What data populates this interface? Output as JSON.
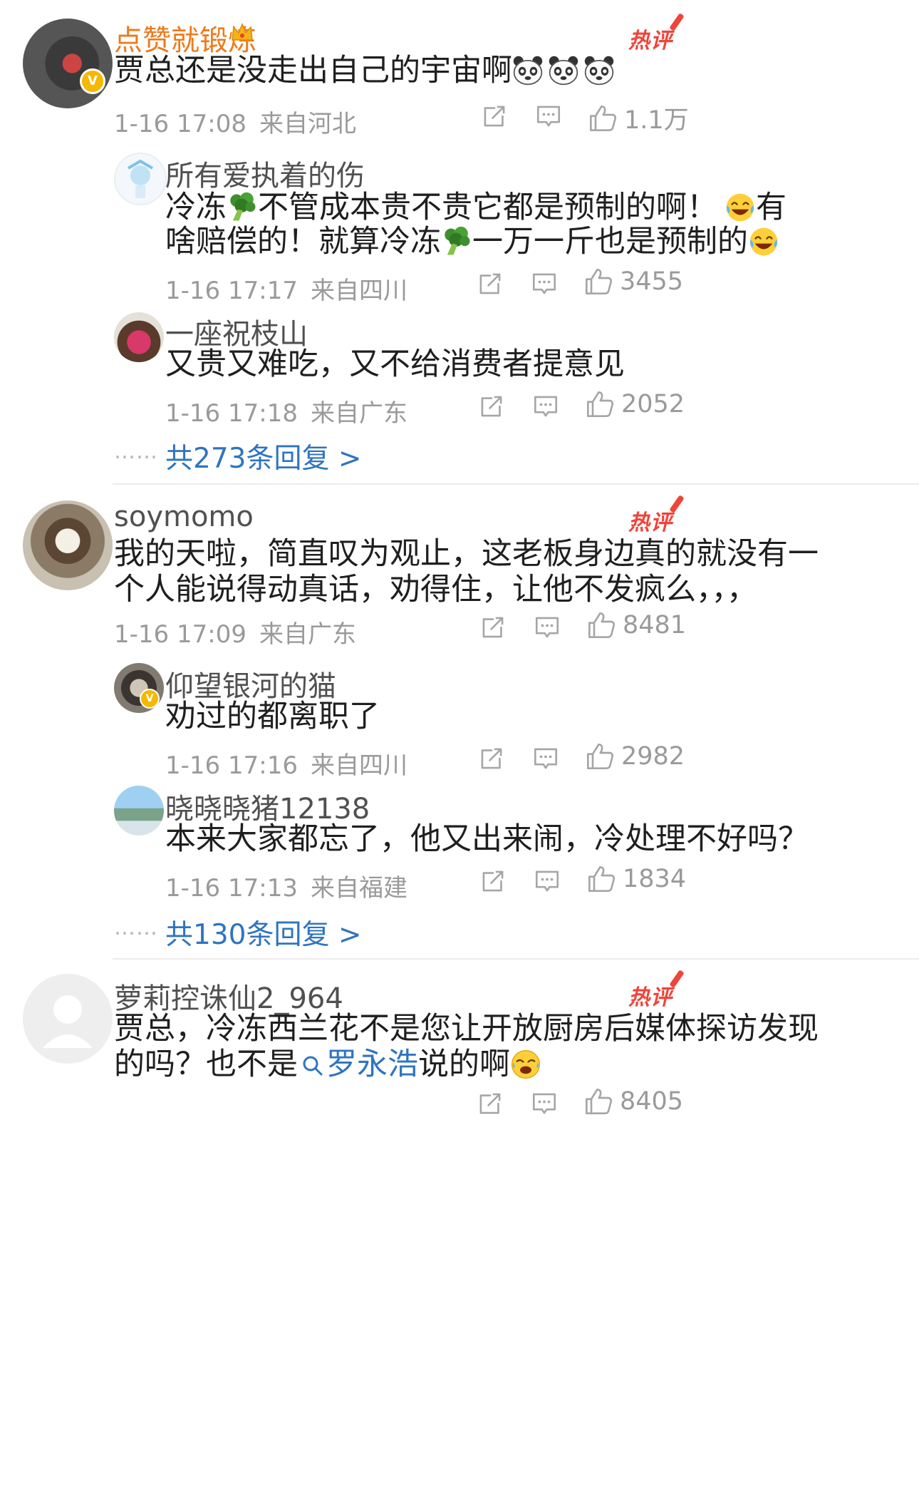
{
  "hot_label": "热评",
  "comments": [
    {
      "user": "点赞就锻炼",
      "text": "贾总还是没走出自己的宇宙啊",
      "time": "1-16 17:08",
      "location": "来自河北",
      "likes": "1.1万",
      "replies": [
        {
          "user": "所有爱执着的伤",
          "text_line1_a": "冷冻",
          "text_line1_b": "不管成本贵不贵它都是预制的啊！",
          "text_line1_c": "有",
          "text_line2_a": "啥赔偿的！就算冷冻",
          "text_line2_b": "一万一斤也是预制的",
          "time": "1-16 17:17",
          "location": "来自四川",
          "likes": "3455"
        },
        {
          "user": "一座祝枝山",
          "text": "又贵又难吃，又不给消费者提意见",
          "time": "1-16 17:18",
          "location": "来自广东",
          "likes": "2052"
        }
      ],
      "more_dots": "……",
      "more_replies": "共273条回复 >"
    },
    {
      "user": "soymomo",
      "text_line1": "我的天啦，简直叹为观止，这老板身边真的就没有一",
      "text_line2": "个人能说得动真话，劝得住，让他不发疯么，，，",
      "time": "1-16 17:09",
      "location": "来自广东",
      "likes": "8481",
      "replies": [
        {
          "user": "仰望银河的猫",
          "text": "劝过的都离职了",
          "time": "1-16 17:16",
          "location": "来自四川",
          "likes": "2982"
        },
        {
          "user": "晓晓晓猪12138",
          "text": "本来大家都忘了，他又出来闹，冷处理不好吗？",
          "time": "1-16 17:13",
          "location": "来自福建",
          "likes": "1834"
        }
      ],
      "more_dots": "……",
      "more_replies": "共130条回复 >"
    },
    {
      "user": "萝莉控诛仙2_964",
      "text_line1": "贾总，冷冻西兰花不是您让开放厨房后媒体探访发现",
      "text_line2_a": "的吗？也不是",
      "text_line2_link": "罗永浩",
      "text_line2_b": "说的啊",
      "likes": "8405"
    }
  ],
  "colors": {
    "accent_orange": "#ee7a1a",
    "link_blue": "#2f74c0",
    "hot_red": "#f0443a",
    "meta_gray": "#9a9a9a"
  },
  "icons": [
    "crown-icon",
    "verified-badge-icon",
    "panda-emoji-icon",
    "broccoli-emoji-icon",
    "laughing-emoji-icon",
    "repost-icon",
    "comment-icon",
    "like-icon",
    "search-icon",
    "crying-laugh-emoji-icon"
  ]
}
